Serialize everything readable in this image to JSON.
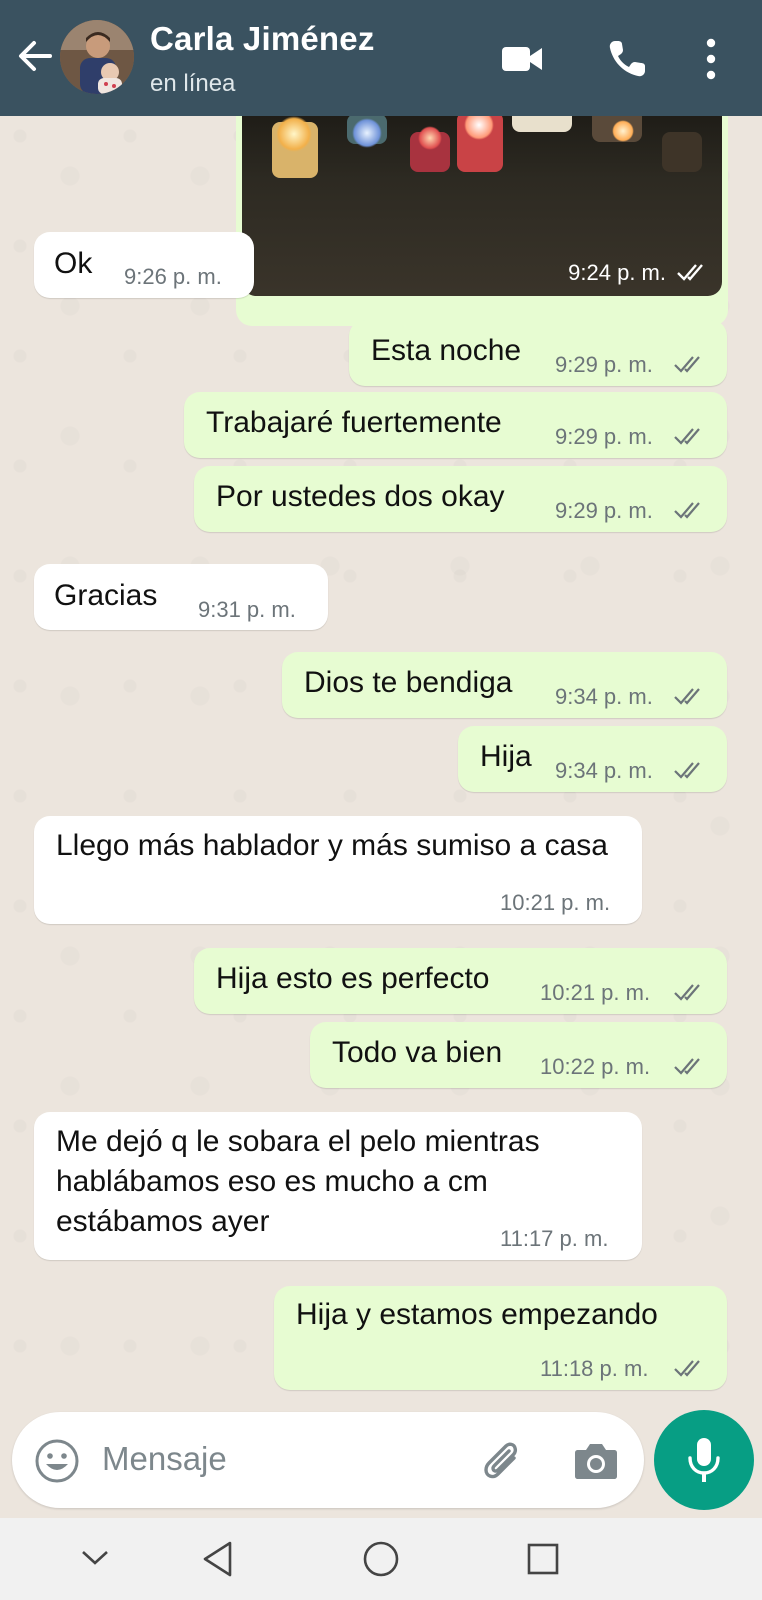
{
  "header": {
    "back_icon": "arrow-left-icon",
    "contact_name": "Carla Jiménez",
    "status": "en línea",
    "video_icon": "video-camera-icon",
    "call_icon": "phone-icon",
    "menu_icon": "more-vertical-icon",
    "background_color": "#3a5260"
  },
  "chat": {
    "image_message": {
      "time": "9:24 p. m.",
      "read": true
    },
    "messages": [
      {
        "dir": "in",
        "text": "Ok",
        "time": "9:26 p. m."
      },
      {
        "dir": "out",
        "text": "Esta noche",
        "time": "9:29 p. m.",
        "read": true
      },
      {
        "dir": "out",
        "text": "Trabajaré fuertemente",
        "time": "9:29 p. m.",
        "read": true
      },
      {
        "dir": "out",
        "text": "Por ustedes dos okay",
        "time": "9:29 p. m.",
        "read": true
      },
      {
        "dir": "in",
        "text": "Gracias",
        "time": "9:31 p. m."
      },
      {
        "dir": "out",
        "text": "Dios te bendiga",
        "time": "9:34 p. m.",
        "read": true
      },
      {
        "dir": "out",
        "text": "Hija",
        "time": "9:34 p. m.",
        "read": true
      },
      {
        "dir": "in",
        "text": "Llego más hablador y más sumiso a casa",
        "time": "10:21 p. m."
      },
      {
        "dir": "out",
        "text": "Hija esto es perfecto",
        "time": "10:21 p. m.",
        "read": true
      },
      {
        "dir": "out",
        "text": "Todo va bien",
        "time": "10:22 p. m.",
        "read": true
      },
      {
        "dir": "in",
        "text": "Me dejó q le sobara el pelo mientras hablábamos eso es mucho a cm estábamos ayer",
        "time": "11:17 p. m."
      },
      {
        "dir": "out",
        "text": "Hija y estamos empezando",
        "time": "11:18 p. m.",
        "read": true
      }
    ],
    "incoming_color": "#ffffff",
    "outgoing_color": "#e7fcd2",
    "read_tick_color": "#6c7479"
  },
  "composer": {
    "placeholder": "Mensaje",
    "emoji_icon": "emoji-icon",
    "attach_icon": "paperclip-icon",
    "camera_icon": "camera-icon",
    "mic_icon": "microphone-icon",
    "accent_color": "#079e84"
  },
  "navbar": {
    "icons": [
      "chevron-down-icon",
      "back-triangle-icon",
      "home-circle-icon",
      "recents-square-icon"
    ]
  }
}
